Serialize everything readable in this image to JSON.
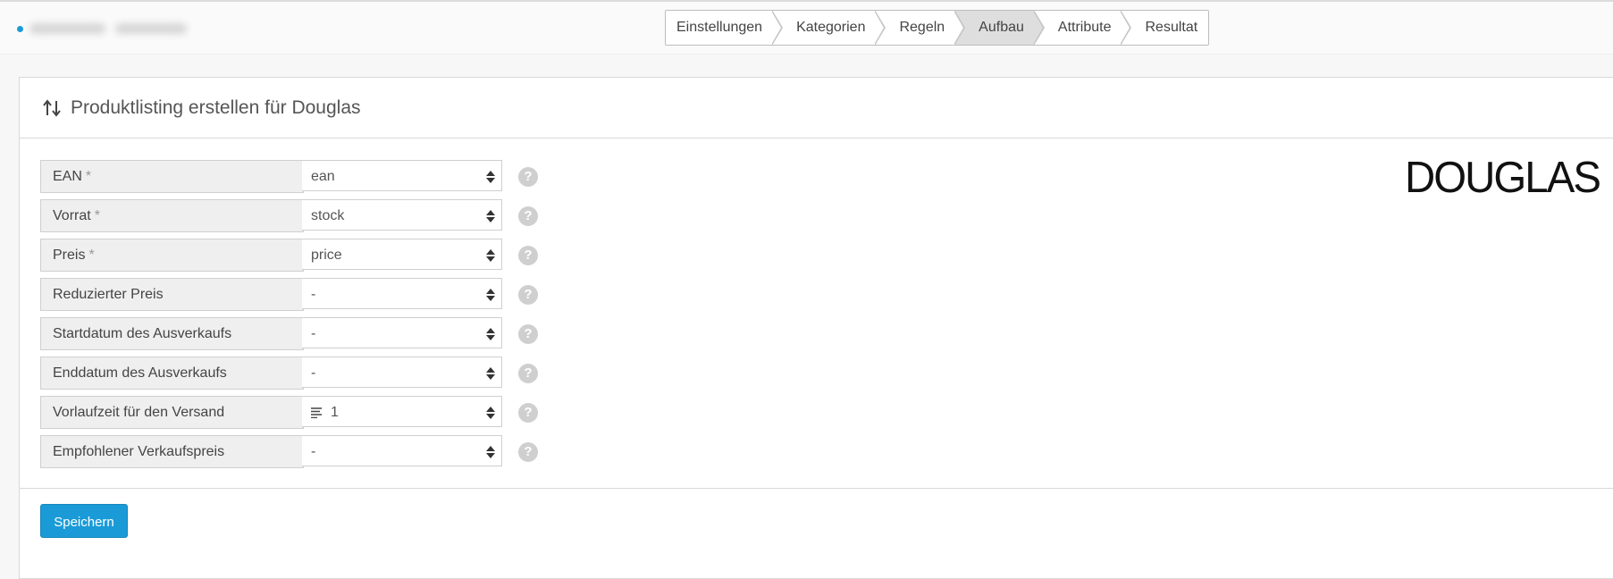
{
  "wizard": {
    "steps": [
      "Einstellungen",
      "Kategorien",
      "Regeln",
      "Aufbau",
      "Attribute",
      "Resultat"
    ],
    "active_step": "Aufbau"
  },
  "panel": {
    "title": "Produktlisting erstellen für Douglas",
    "brand_logo": "DOUGLAS"
  },
  "fields": [
    {
      "label": "EAN",
      "required_mark": "*",
      "value": "ean"
    },
    {
      "label": "Vorrat",
      "required_mark": "*",
      "value": "stock"
    },
    {
      "label": "Preis",
      "required_mark": "*",
      "value": "price"
    },
    {
      "label": "Reduzierter Preis",
      "required_mark": "",
      "value": "-"
    },
    {
      "label": "Startdatum des Ausverkaufs",
      "required_mark": "",
      "value": "-"
    },
    {
      "label": "Enddatum des Ausverkaufs",
      "required_mark": "",
      "value": "-"
    },
    {
      "label": "Vorlaufzeit für den Versand",
      "required_mark": "",
      "value": "1",
      "icon": "text-lines-icon"
    },
    {
      "label": "Empfohlener Verkaufspreis",
      "required_mark": "",
      "value": "-"
    }
  ],
  "help_symbol": "?",
  "actions": {
    "save_label": "Speichern"
  },
  "colors": {
    "accent": "#1a9bd7",
    "active_step_bg": "#dedede"
  }
}
